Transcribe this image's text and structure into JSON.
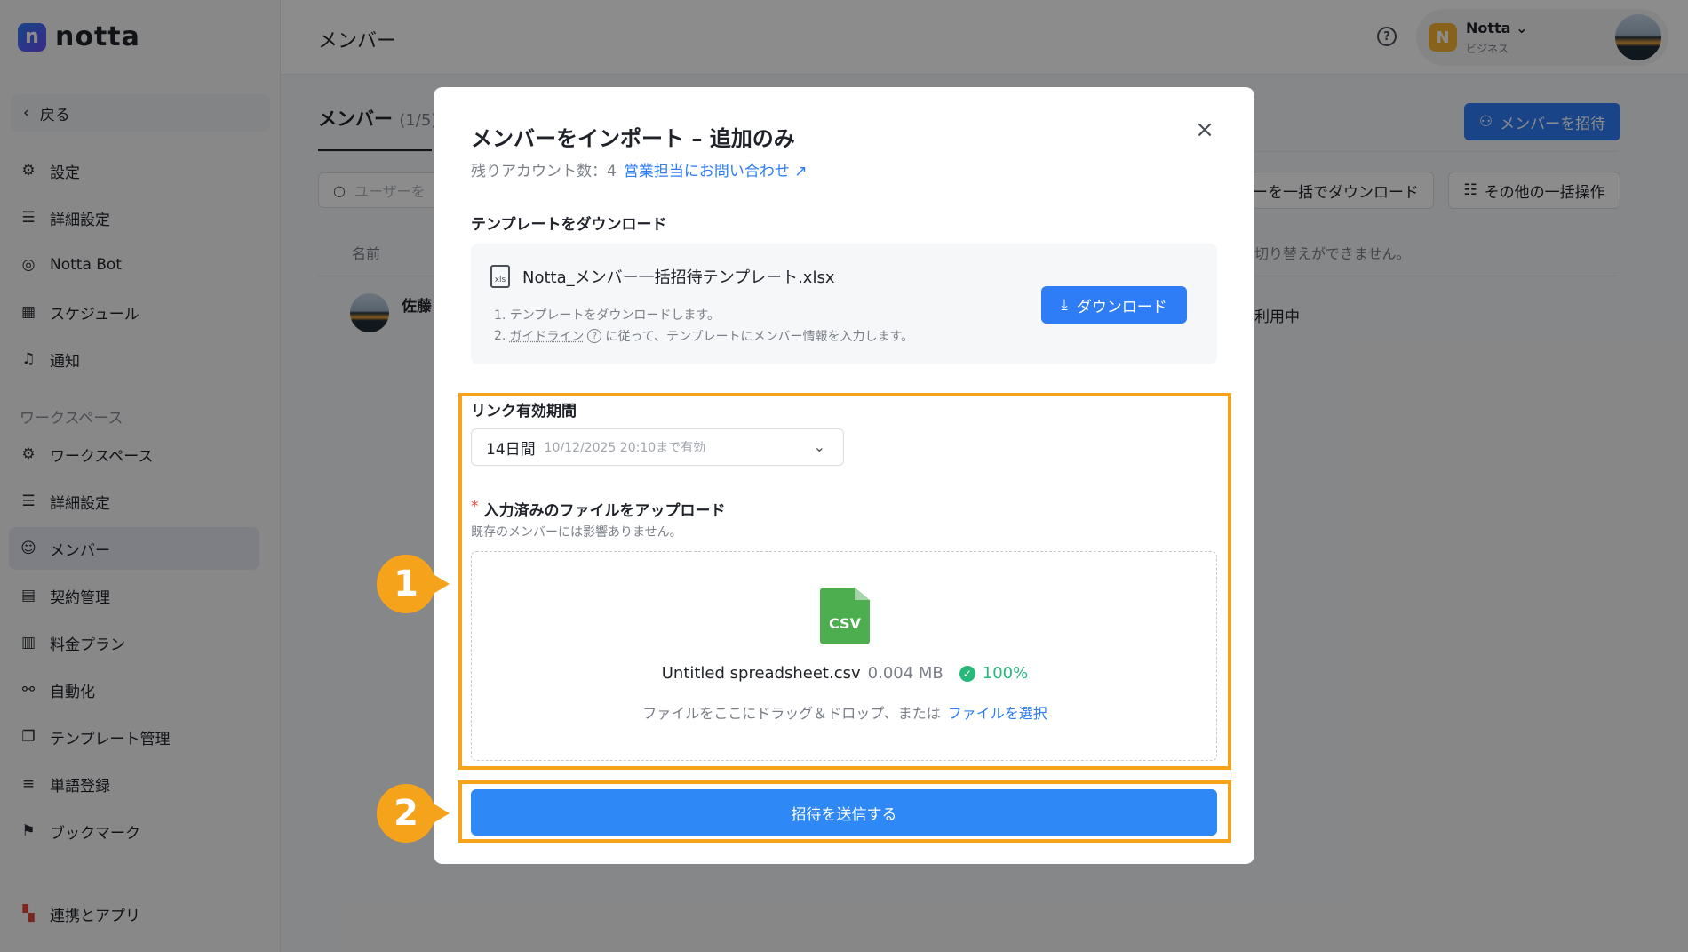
{
  "app": {
    "logo_text": "notta",
    "logo_letter": "n"
  },
  "sidebar": {
    "back_label": "戻る",
    "items_top": [
      {
        "label": "設定",
        "icon": "gear-icon"
      },
      {
        "label": "詳細設定",
        "icon": "sliders-icon"
      },
      {
        "label": "Notta Bot",
        "icon": "bot-icon"
      },
      {
        "label": "スケジュール",
        "icon": "calendar-icon"
      },
      {
        "label": "通知",
        "icon": "bell-icon"
      }
    ],
    "section_workspace": "ワークスペース",
    "items_workspace": [
      {
        "label": "ワークスペース",
        "icon": "gear-icon"
      },
      {
        "label": "詳細設定",
        "icon": "sliders-icon"
      },
      {
        "label": "メンバー",
        "icon": "users-icon",
        "active": true
      },
      {
        "label": "契約管理",
        "icon": "contract-icon"
      },
      {
        "label": "料金プラン",
        "icon": "map-icon"
      },
      {
        "label": "自動化",
        "icon": "automation-icon"
      },
      {
        "label": "テンプレート管理",
        "icon": "template-icon"
      },
      {
        "label": "単語登録",
        "icon": "list-icon"
      },
      {
        "label": "ブックマーク",
        "icon": "bookmark-icon"
      }
    ],
    "integrations_label": "連携とアプリ"
  },
  "header": {
    "title": "メンバー",
    "account_name": "Notta",
    "account_badge": "N",
    "account_plan": "ビジネス"
  },
  "main": {
    "tab_label": "メンバー",
    "tab_count": "(1/5)",
    "invite_button": "メンバーを招待",
    "search_placeholder": "ユーザーを",
    "bulk_download_button": "ーを一括でダウンロード",
    "bulk_ops_button": "その他の一括操作",
    "col_name": "名前",
    "note_right": "切り替えができません。",
    "member_name": "佐藤",
    "member_status": "利用中"
  },
  "modal": {
    "title": "メンバーをインポート – 追加のみ",
    "remaining_label": "残りアカウント数：4",
    "contact_link": "営業担当にお問い合わせ",
    "template_heading": "テンプレートをダウンロード",
    "template_icon_text": "xls",
    "template_file": "Notta_メンバー一括招待テンプレート.xlsx",
    "step1": "1. テンプレートをダウンロードします。",
    "step2_prefix": "2.",
    "step2_link": "ガイドライン",
    "step2_suffix": "に従って、テンプレートにメンバー情報を入力します。",
    "download_button": "ダウンロード",
    "link_validity_label": "リンク有効期間",
    "select_value": "14日間",
    "select_sub": "10/12/2025 20:10まで有効",
    "required_mark": "*",
    "upload_label": "入力済みのファイルをアップロード",
    "upload_note": "既存のメンバーには影響ありません。",
    "csv_icon_text": "CSV",
    "file_name": "Untitled spreadsheet.csv",
    "file_size": "0.004 MB",
    "file_progress": "100%",
    "drop_hint": "ファイルをここにドラッグ＆ドロップ、または",
    "choose_file_link": "ファイルを選択",
    "submit_button": "招待を送信する"
  },
  "callouts": {
    "one": "1",
    "two": "2"
  },
  "colors": {
    "accent": "#2e7cf6",
    "highlight": "#f5a31a",
    "success": "#27b87a"
  }
}
